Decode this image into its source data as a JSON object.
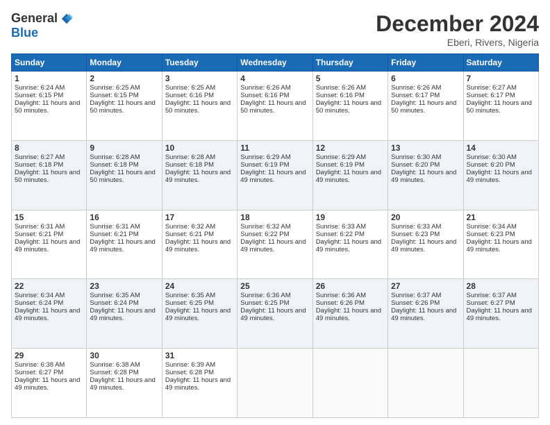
{
  "header": {
    "logo_general": "General",
    "logo_blue": "Blue",
    "title": "December 2024",
    "location": "Eberi, Rivers, Nigeria"
  },
  "days": [
    "Sunday",
    "Monday",
    "Tuesday",
    "Wednesday",
    "Thursday",
    "Friday",
    "Saturday"
  ],
  "weeks": [
    [
      {
        "day": "1",
        "sunrise": "6:24 AM",
        "sunset": "6:15 PM",
        "daylight": "11 hours and 50 minutes."
      },
      {
        "day": "2",
        "sunrise": "6:25 AM",
        "sunset": "6:15 PM",
        "daylight": "11 hours and 50 minutes."
      },
      {
        "day": "3",
        "sunrise": "6:25 AM",
        "sunset": "6:16 PM",
        "daylight": "11 hours and 50 minutes."
      },
      {
        "day": "4",
        "sunrise": "6:26 AM",
        "sunset": "6:16 PM",
        "daylight": "11 hours and 50 minutes."
      },
      {
        "day": "5",
        "sunrise": "6:26 AM",
        "sunset": "6:16 PM",
        "daylight": "11 hours and 50 minutes."
      },
      {
        "day": "6",
        "sunrise": "6:26 AM",
        "sunset": "6:17 PM",
        "daylight": "11 hours and 50 minutes."
      },
      {
        "day": "7",
        "sunrise": "6:27 AM",
        "sunset": "6:17 PM",
        "daylight": "11 hours and 50 minutes."
      }
    ],
    [
      {
        "day": "8",
        "sunrise": "6:27 AM",
        "sunset": "6:18 PM",
        "daylight": "11 hours and 50 minutes."
      },
      {
        "day": "9",
        "sunrise": "6:28 AM",
        "sunset": "6:18 PM",
        "daylight": "11 hours and 50 minutes."
      },
      {
        "day": "10",
        "sunrise": "6:28 AM",
        "sunset": "6:18 PM",
        "daylight": "11 hours and 49 minutes."
      },
      {
        "day": "11",
        "sunrise": "6:29 AM",
        "sunset": "6:19 PM",
        "daylight": "11 hours and 49 minutes."
      },
      {
        "day": "12",
        "sunrise": "6:29 AM",
        "sunset": "6:19 PM",
        "daylight": "11 hours and 49 minutes."
      },
      {
        "day": "13",
        "sunrise": "6:30 AM",
        "sunset": "6:20 PM",
        "daylight": "11 hours and 49 minutes."
      },
      {
        "day": "14",
        "sunrise": "6:30 AM",
        "sunset": "6:20 PM",
        "daylight": "11 hours and 49 minutes."
      }
    ],
    [
      {
        "day": "15",
        "sunrise": "6:31 AM",
        "sunset": "6:21 PM",
        "daylight": "11 hours and 49 minutes."
      },
      {
        "day": "16",
        "sunrise": "6:31 AM",
        "sunset": "6:21 PM",
        "daylight": "11 hours and 49 minutes."
      },
      {
        "day": "17",
        "sunrise": "6:32 AM",
        "sunset": "6:21 PM",
        "daylight": "11 hours and 49 minutes."
      },
      {
        "day": "18",
        "sunrise": "6:32 AM",
        "sunset": "6:22 PM",
        "daylight": "11 hours and 49 minutes."
      },
      {
        "day": "19",
        "sunrise": "6:33 AM",
        "sunset": "6:22 PM",
        "daylight": "11 hours and 49 minutes."
      },
      {
        "day": "20",
        "sunrise": "6:33 AM",
        "sunset": "6:23 PM",
        "daylight": "11 hours and 49 minutes."
      },
      {
        "day": "21",
        "sunrise": "6:34 AM",
        "sunset": "6:23 PM",
        "daylight": "11 hours and 49 minutes."
      }
    ],
    [
      {
        "day": "22",
        "sunrise": "6:34 AM",
        "sunset": "6:24 PM",
        "daylight": "11 hours and 49 minutes."
      },
      {
        "day": "23",
        "sunrise": "6:35 AM",
        "sunset": "6:24 PM",
        "daylight": "11 hours and 49 minutes."
      },
      {
        "day": "24",
        "sunrise": "6:35 AM",
        "sunset": "6:25 PM",
        "daylight": "11 hours and 49 minutes."
      },
      {
        "day": "25",
        "sunrise": "6:36 AM",
        "sunset": "6:25 PM",
        "daylight": "11 hours and 49 minutes."
      },
      {
        "day": "26",
        "sunrise": "6:36 AM",
        "sunset": "6:26 PM",
        "daylight": "11 hours and 49 minutes."
      },
      {
        "day": "27",
        "sunrise": "6:37 AM",
        "sunset": "6:26 PM",
        "daylight": "11 hours and 49 minutes."
      },
      {
        "day": "28",
        "sunrise": "6:37 AM",
        "sunset": "6:27 PM",
        "daylight": "11 hours and 49 minutes."
      }
    ],
    [
      {
        "day": "29",
        "sunrise": "6:38 AM",
        "sunset": "6:27 PM",
        "daylight": "11 hours and 49 minutes."
      },
      {
        "day": "30",
        "sunrise": "6:38 AM",
        "sunset": "6:28 PM",
        "daylight": "11 hours and 49 minutes."
      },
      {
        "day": "31",
        "sunrise": "6:39 AM",
        "sunset": "6:28 PM",
        "daylight": "11 hours and 49 minutes."
      },
      null,
      null,
      null,
      null
    ]
  ]
}
